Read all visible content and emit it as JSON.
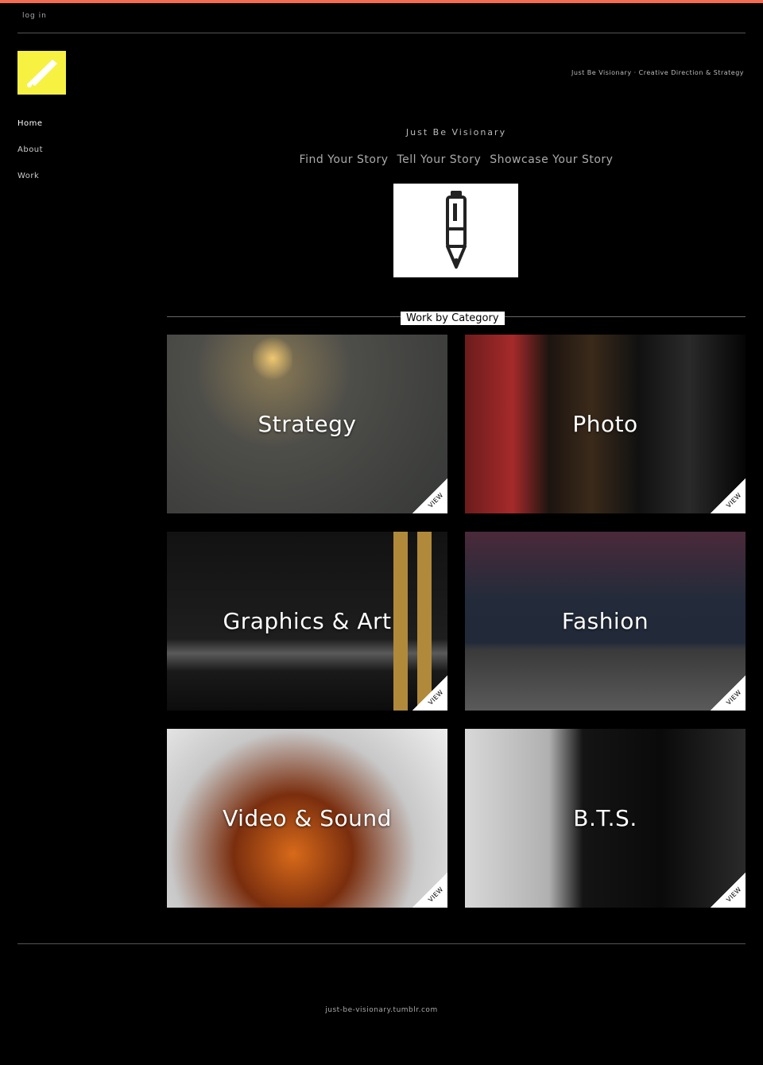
{
  "colors": {
    "accent_bar": "#f26b52",
    "logo_bg": "#f7f142"
  },
  "header": {
    "login_label": "log in",
    "tagline": "Just Be Visionary · Creative Direction & Strategy"
  },
  "nav": {
    "items": [
      {
        "label": "Home"
      },
      {
        "label": "About"
      },
      {
        "label": "Work"
      }
    ]
  },
  "hero": {
    "subtitle": "Just Be Visionary",
    "mottos": [
      "Find Your Story",
      "Tell Your Story",
      "Showcase Your Story"
    ]
  },
  "section": {
    "title": "Work by Category"
  },
  "tiles": [
    {
      "label": "Strategy",
      "badge": "VIEW"
    },
    {
      "label": "Photo",
      "badge": "VIEW"
    },
    {
      "label": "Graphics & Art",
      "badge": "VIEW"
    },
    {
      "label": "Fashion",
      "badge": "VIEW"
    },
    {
      "label": "Video & Sound",
      "badge": "VIEW"
    },
    {
      "label": "B.T.S.",
      "badge": "VIEW"
    }
  ],
  "footer": {
    "text": "just-be-visionary.tumblr.com"
  },
  "icons": {
    "logo": "pen-stroke-icon",
    "hero": "pen-icon"
  }
}
